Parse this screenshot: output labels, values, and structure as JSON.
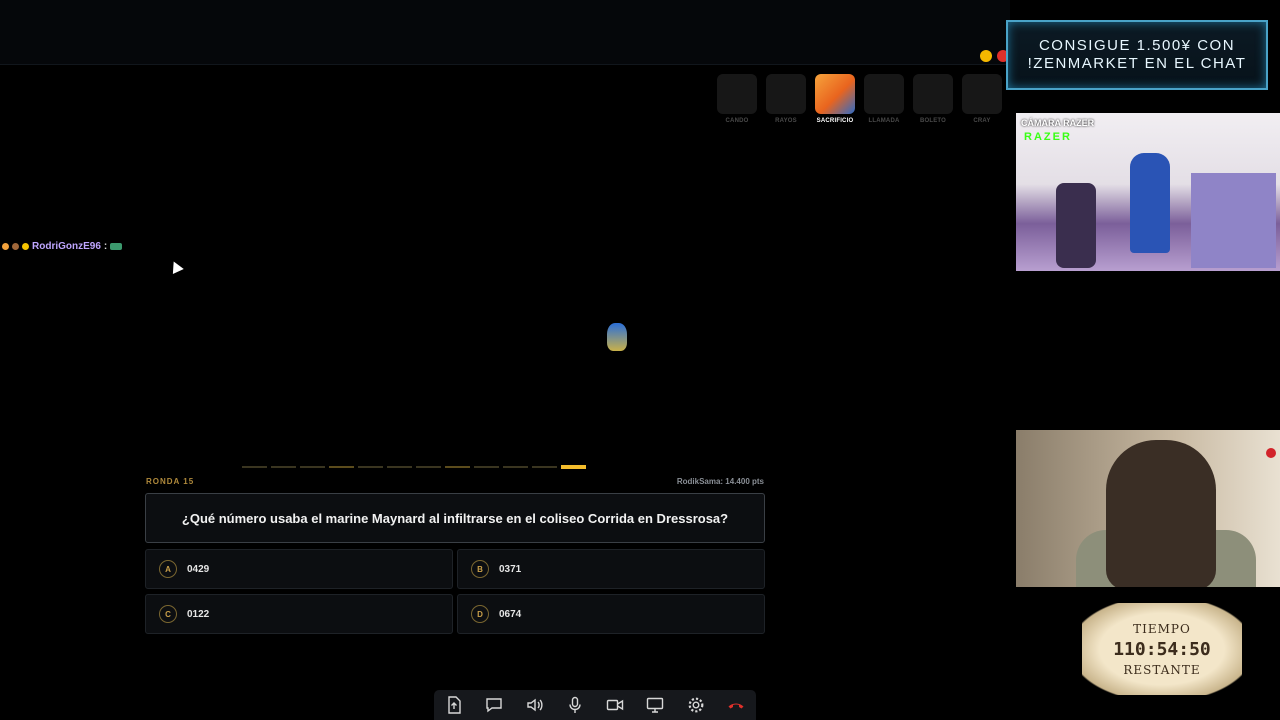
{
  "banner": {
    "line1": "CONSIGUE 1.500¥ CON",
    "line2": "!ZENMARKET EN EL CHAT"
  },
  "cards": [
    {
      "label": "CANDO",
      "active": false
    },
    {
      "label": "RAYOS",
      "active": false
    },
    {
      "label": "SACRIFICIO",
      "active": true
    },
    {
      "label": "LLAMADA",
      "active": false
    },
    {
      "label": "BOLETO",
      "active": false
    },
    {
      "label": "CRAY",
      "active": false
    }
  ],
  "chat": {
    "user": "RodriGonzE96",
    "separator": ":"
  },
  "quiz": {
    "round": "RONDA 15",
    "score": "RodikSama: 14.400 pts",
    "question": "¿Qué número usaba el marine Maynard al infiltrarse en el coliseo Corrida en Dressrosa?",
    "progress_total": 12,
    "progress_current": 12,
    "answers": [
      {
        "letter": "A",
        "text": "0429"
      },
      {
        "letter": "B",
        "text": "0371"
      },
      {
        "letter": "C",
        "text": "0122"
      },
      {
        "letter": "D",
        "text": "0674"
      }
    ]
  },
  "camera1": {
    "label": "CÁMARA RAZER",
    "brand": "RAZER"
  },
  "timer": {
    "top": "TIEMPO",
    "value": "110:54:50",
    "bottom": "RESTANTE"
  },
  "toolbar": {
    "icons": [
      "upload-file-icon",
      "chat-icon",
      "volume-icon",
      "microphone-icon",
      "camera-icon",
      "screen-share-icon",
      "settings-icon",
      "hang-up-icon"
    ]
  },
  "colors": {
    "accent": "#f4bd2c",
    "banner_border": "#4aa3c8",
    "hang_up": "#e0302a"
  }
}
